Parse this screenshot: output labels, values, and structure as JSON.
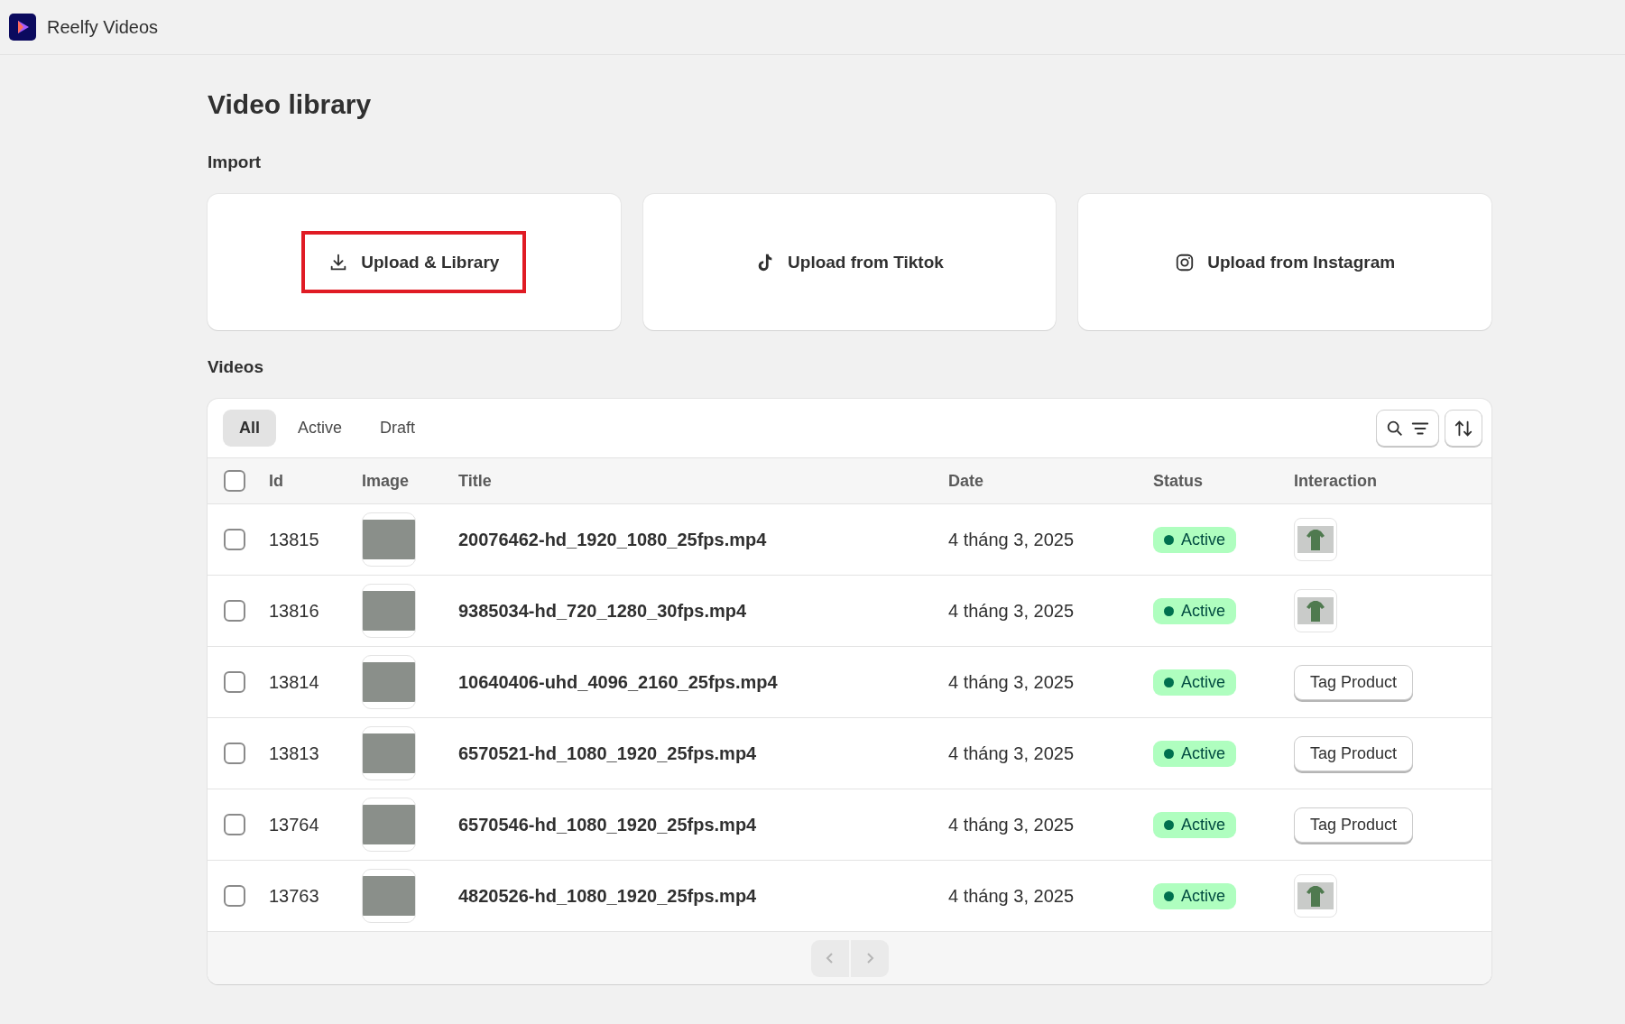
{
  "app": {
    "title": "Reelfy Videos"
  },
  "page": {
    "title": "Video library"
  },
  "import": {
    "heading": "Import",
    "options": [
      {
        "kind": "library",
        "label": "Upload & Library",
        "highlighted": true
      },
      {
        "kind": "tiktok",
        "label": "Upload from Tiktok",
        "highlighted": false
      },
      {
        "kind": "instagram",
        "label": "Upload from Instagram",
        "highlighted": false
      }
    ]
  },
  "videos": {
    "heading": "Videos",
    "tabs": [
      {
        "label": "All",
        "selected": true
      },
      {
        "label": "Active",
        "selected": false
      },
      {
        "label": "Draft",
        "selected": false
      }
    ],
    "select_all": {
      "checked": false
    },
    "columns": [
      "Id",
      "Image",
      "Title",
      "Date",
      "Status",
      "Interaction"
    ],
    "rows": [
      {
        "checked": false,
        "id": "13815",
        "title": "20076462-hd_1920_1080_25fps.mp4",
        "date": "4 tháng 3, 2025",
        "status": "Active",
        "interaction": {
          "kind": "product"
        }
      },
      {
        "checked": false,
        "id": "13816",
        "title": "9385034-hd_720_1280_30fps.mp4",
        "date": "4 tháng 3, 2025",
        "status": "Active",
        "interaction": {
          "kind": "product"
        }
      },
      {
        "checked": false,
        "id": "13814",
        "title": "10640406-uhd_4096_2160_25fps.mp4",
        "date": "4 tháng 3, 2025",
        "status": "Active",
        "interaction": {
          "kind": "button",
          "label": "Tag Product"
        }
      },
      {
        "checked": false,
        "id": "13813",
        "title": "6570521-hd_1080_1920_25fps.mp4",
        "date": "4 tháng 3, 2025",
        "status": "Active",
        "interaction": {
          "kind": "button",
          "label": "Tag Product"
        }
      },
      {
        "checked": false,
        "id": "13764",
        "title": "6570546-hd_1080_1920_25fps.mp4",
        "date": "4 tháng 3, 2025",
        "status": "Active",
        "interaction": {
          "kind": "button",
          "label": "Tag Product"
        }
      },
      {
        "checked": false,
        "id": "13763",
        "title": "4820526-hd_1080_1920_25fps.mp4",
        "date": "4 tháng 3, 2025",
        "status": "Active",
        "interaction": {
          "kind": "product"
        }
      }
    ]
  }
}
